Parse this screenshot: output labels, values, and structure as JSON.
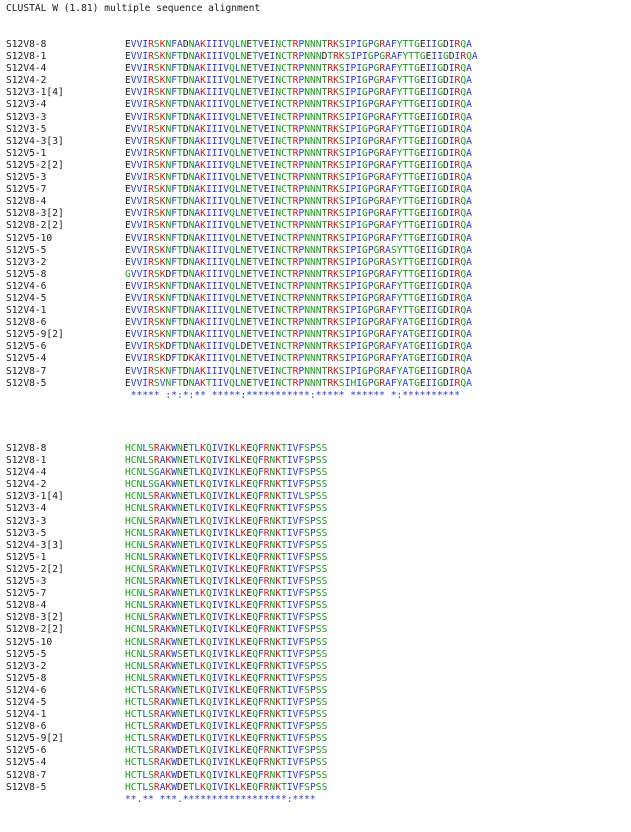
{
  "header": {
    "title": "CLUSTAL W (1.81) multiple sequence alignment"
  },
  "colors": {
    "blue": "#2a38d8",
    "green": "#16a016",
    "red": "#d21a1a",
    "black": "#1a1a1a",
    "background": "#ffffff"
  },
  "blocks": [
    {
      "rows": [
        {
          "name": "S12V8-8",
          "seq": "EVVIRSKNFADNAKIIIVQLNETVEINCTRPNNNTRKSIPIGPGRAFYTTGEIIGDIRQA"
        },
        {
          "name": "S12V8-1",
          "seq": "EVVIRSKNFTDNAKIIIVQLNETVEINCTRPNNNDTRKSIPIGPGRAFYTTGEIIGDIRQA"
        },
        {
          "name": "S12V4-4",
          "seq": "EVVIRSKNFTDNAKIIIVQLNETVEINCTRPNNNTRKSIPIGPGRAFYTTGEIIGDIRQA"
        },
        {
          "name": "S12V4-2",
          "seq": "EVVIRSKNFTDNAKIIIVQLNETVEINCTRPNNNTRKSIPIGPGRAFYTTGEIIGDIRQA"
        },
        {
          "name": "S12V3-1[4]",
          "seq": "EVVIRSKNFTDNAKIIIVQLNETVEINCTRPNNNTRKSIPIGPGRAFYTTGEIIGDIRQA"
        },
        {
          "name": "S12V3-4",
          "seq": "EVVIRSKNFTDNAKIIIVQLNETVEINCTRPNNNTRKSIPIGPGRAFYTTGEIIGDIRQA"
        },
        {
          "name": "S12V3-3",
          "seq": "EVVIRSKNFTDNAKIIIVQLNETVEINCTRPNNNTRKSIPIGPGRAFYTTGEIIGDIRQA"
        },
        {
          "name": "S12V3-5",
          "seq": "EVVIRSKNFTDNAKIIIVQLNETVEINCTRPNNNTRKSIPIGPGRAFYTTGEIIGDIRQA"
        },
        {
          "name": "S12V4-3[3]",
          "seq": "EVVIRSKNFTDNAKIIIVQLNETVEINCTRPNNNTRKSIPIGPGRAFYTTGEIIGDIRQA"
        },
        {
          "name": "S12V5-1",
          "seq": "EVVIRSKNFTDNAKIIIVQLNETVEINCTRPNNNTRKSIPIGPGRAFYTTGEIIGDIRQA"
        },
        {
          "name": "S12V5-2[2]",
          "seq": "EVVIRSKNFTDNAKIIIVQLNETVEINCTRPNNNTRKSIPIGPGRAFYTTGEIIGDIRQA"
        },
        {
          "name": "S12V5-3",
          "seq": "EVVIRSKNFTDNAKIIIVQLNETVEINCTRPNNNTRKSIPIGPGRAFYTTGEIIGDIRQA"
        },
        {
          "name": "S12V5-7",
          "seq": "EVVIRSKNFTDNAKIIIVQLNETVEINCTRPNNNTRKSIPIGPGRAFYTTGEIIGDIRQA"
        },
        {
          "name": "S12V8-4",
          "seq": "EVVIRSKNFTDNAKIIIVQLNETVEINCTRPNNNTRKSIPIGPGRAFYTTGEIIGDIRQA"
        },
        {
          "name": "S12V8-3[2]",
          "seq": "EVVIRSKNFTDNAKIIIVQLNETVEINCTRPNNNTRKSIPIGPGRAFYTTGEIIGDIRQA"
        },
        {
          "name": "S12V8-2[2]",
          "seq": "EVVIRSKNFTDNAKIIIVQLNETVEINCTRPNNNTRKSIPIGPGRAFYTTGEIIGDIRQA"
        },
        {
          "name": "S12V5-10",
          "seq": "EVVIRSKNFTDNAKIIIVQLNETVEINCTRPNNNTRKSIPIGPGRAFYTTGEIIGDIRQA"
        },
        {
          "name": "S12V5-5",
          "seq": "EVVIRSKNFTDNAKIIIVQLNETVEINCTRPNNNTRKSIPIGPGRASYTTGEIIGDIRQA"
        },
        {
          "name": "S12V3-2",
          "seq": "EVVIRSKNFTDNAKIIIVQLNETVEINCTRPNNNTRKSIPIGPGRASYTTGEIIGDIRQA"
        },
        {
          "name": "S12V5-8",
          "seq": "GVVIRSKDFTDNAKIIIVQLNETVEINCTRPNNNTRKSIPIGPGRAFYTTGEIIGDIRQA"
        },
        {
          "name": "S12V4-6",
          "seq": "EVVIRSKNFTDNAKIIIVQLNETVEINCTRPNNNTRKSIPIGPGRAFYTTGEIIGDIRQA"
        },
        {
          "name": "S12V4-5",
          "seq": "EVVIRSKNFTDNAKIIIVQLNETVEINCTRPNNNTRKSIPIGPGRAFYTTGEIIGDIRQA"
        },
        {
          "name": "S12V4-1",
          "seq": "EVVIRSKNFTDNAKIIIVQLNETVEINCTRPNNNTRKSIPIGPGRAFYTTGEIIGDIRQA"
        },
        {
          "name": "S12V8-6",
          "seq": "EVVIRSKNFTDNAKIIIVQLNETVEINCTRPNNNTRKSIPIGPGRAFYATGEIIGDIRQA"
        },
        {
          "name": "S12V5-9[2]",
          "seq": "EVVIRSKNFTDNAKIIIVQLNETVEINCTRPNNNTRKSIPIGPGRAFYATGEIIGDIRQA"
        },
        {
          "name": "S12V5-6",
          "seq": "EVVIRSKDFTDNAKIIIVQLDETVEINCTRPNNNTRKSIPIGPGRAFYATGEIIGDIRQA"
        },
        {
          "name": "S12V5-4",
          "seq": "EVVIRSKDFTDKAKIIIVQLNETVEINCTRPNNNTRKSIPIGPGRAFYATGEIIGDIRQA"
        },
        {
          "name": "S12V8-7",
          "seq": "EVVIRSKNFTDNAKIIIVQLNETVEINCTRPNNNTRKSIPIGPGRAFYATGEIIGDIRQA"
        },
        {
          "name": "S12V8-5",
          "seq": "EVVIRSVNFTDNAKTIIVQLNETVEINCTRPNNNTRKSIHIGPGRAFYATGEIIGDIRQA"
        }
      ],
      "consensus": " ***** :*:*:** *****:***********:***** ****** *:**********"
    },
    {
      "rows": [
        {
          "name": "S12V8-8",
          "seq": "HCNLSRAKWNETLKQIVIKLKEQFRNKTIVFSPSS"
        },
        {
          "name": "S12V8-1",
          "seq": "HCNLSRAKWNETLKQIVIKLKEQFRNKTIVFSPSS"
        },
        {
          "name": "S12V4-4",
          "seq": "HCNLSGAKWNETLKQIVIKLKEQFRNKTIVFSPSS"
        },
        {
          "name": "S12V4-2",
          "seq": "HCNLSGAKWNETLKQIVIKLKEQFRNKTIVFSPSS"
        },
        {
          "name": "S12V3-1[4]",
          "seq": "HCNLSRAKWNETLKQIVIKLKEQFRNKTIVLSPSS"
        },
        {
          "name": "S12V3-4",
          "seq": "HCNLSRAKWNETLKQIVIKLKEQFRNKTIVFSPSS"
        },
        {
          "name": "S12V3-3",
          "seq": "HCNLSRAKWNETLKQIVIKLKEQFRNKTIVFSPSS"
        },
        {
          "name": "S12V3-5",
          "seq": "HCNLSRAKWNETLKQIVIKLKEQFRNKTIVFSPSS"
        },
        {
          "name": "S12V4-3[3]",
          "seq": "HCNLSRAKWNETLKQIVIKLKEQFRNKTIVFSPSS"
        },
        {
          "name": "S12V5-1",
          "seq": "HCNLSRAKWNETLKQIVIKLKEQFRNKTIVFSPSS"
        },
        {
          "name": "S12V5-2[2]",
          "seq": "HCNLSRAKWNETLKQIVIKLKEQFRNKTIVFSPSS"
        },
        {
          "name": "S12V5-3",
          "seq": "HCNLSRAKWNETLKQIVIKLKEQFRNKTIVFSPSS"
        },
        {
          "name": "S12V5-7",
          "seq": "HCNLSRAKWNETLKQIVIKLKEQFRNKTIVFSPSS"
        },
        {
          "name": "S12V8-4",
          "seq": "HCNLSRAKWNETLKQIVIKLKEQFRNKTIVFSPSS"
        },
        {
          "name": "S12V8-3[2]",
          "seq": "HCNLSRAKWNETLKQIVIKLKEQFRNKTIVFSPSS"
        },
        {
          "name": "S12V8-2[2]",
          "seq": "HCNLSRAKWNETLKQIVIKLKEQFRNKTIVFSPSS"
        },
        {
          "name": "S12V5-10",
          "seq": "HCNLSRAKWNETLKQIVIKLKEQFRNKTIVFSPSS"
        },
        {
          "name": "S12V5-5",
          "seq": "HCNLSRAKWSETLKQIVIKLKEQFRNKTIVFSPSS"
        },
        {
          "name": "S12V3-2",
          "seq": "HCNLSRAKWNETLKQIVIKLKEQFRNKTIVFSPSS"
        },
        {
          "name": "S12V5-8",
          "seq": "HCNLSRAKWNETLKQIVIKLKEQFRNKTIVFSPSS"
        },
        {
          "name": "S12V4-6",
          "seq": "HCTLSRAKWNETLKQIVIKLKEQFRNKTIVFSPSS"
        },
        {
          "name": "S12V4-5",
          "seq": "HCTLSRAKWNETLKQIVIKLKEQFRNKTIVFSPSS"
        },
        {
          "name": "S12V4-1",
          "seq": "HCTLSRAKWNETLKQIVIKLKEQFRNKTIVFSPSS"
        },
        {
          "name": "S12V8-6",
          "seq": "HCTLSRAKWDETLKQIVIKLKEQFRNKTIVFSPSS"
        },
        {
          "name": "S12V5-9[2]",
          "seq": "HCTLSRAKWDETLKQIVIKLKEQFRNKTIVFSPSS"
        },
        {
          "name": "S12V5-6",
          "seq": "HCTLSRAKWDETLKQIVIKLKEQFRNKTIVFSPSS"
        },
        {
          "name": "S12V5-4",
          "seq": "HCTLSRAKWDETLKQIVIKLKEQFRNKTIVFSPSS"
        },
        {
          "name": "S12V8-7",
          "seq": "HCTLSRAKWDETLKQIVIKLKEQFRNKTIVFSPSS"
        },
        {
          "name": "S12V8-5",
          "seq": "HCTLSRAKWDETLKQIVIKLKEQFRNKTIVFSPSS"
        }
      ],
      "consensus": "**.** ***.******************:****"
    }
  ]
}
